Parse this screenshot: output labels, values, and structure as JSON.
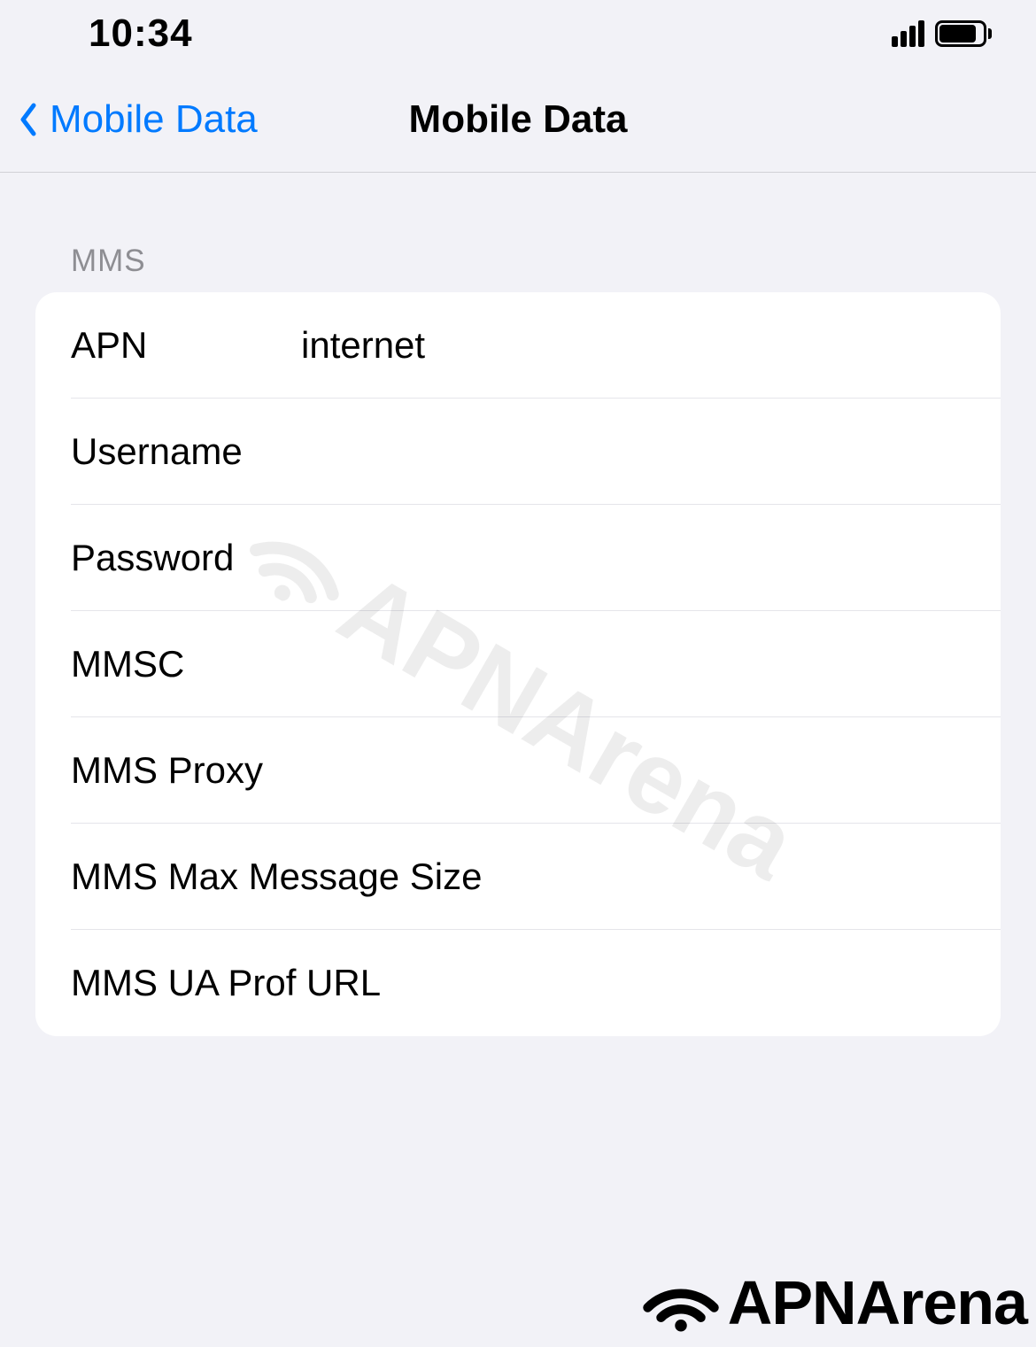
{
  "statusBar": {
    "time": "10:34"
  },
  "navBar": {
    "backLabel": "Mobile Data",
    "title": "Mobile Data"
  },
  "section": {
    "header": "MMS",
    "fields": {
      "apn": {
        "label": "APN",
        "value": "internet"
      },
      "username": {
        "label": "Username",
        "value": ""
      },
      "password": {
        "label": "Password",
        "value": ""
      },
      "mmsc": {
        "label": "MMSC",
        "value": ""
      },
      "mmsProxy": {
        "label": "MMS Proxy",
        "value": ""
      },
      "mmsMaxSize": {
        "label": "MMS Max Message Size",
        "value": ""
      },
      "mmsUaProf": {
        "label": "MMS UA Prof URL",
        "value": ""
      }
    }
  },
  "watermark": {
    "text": "APNArena"
  },
  "brand": {
    "text": "APNArena"
  }
}
